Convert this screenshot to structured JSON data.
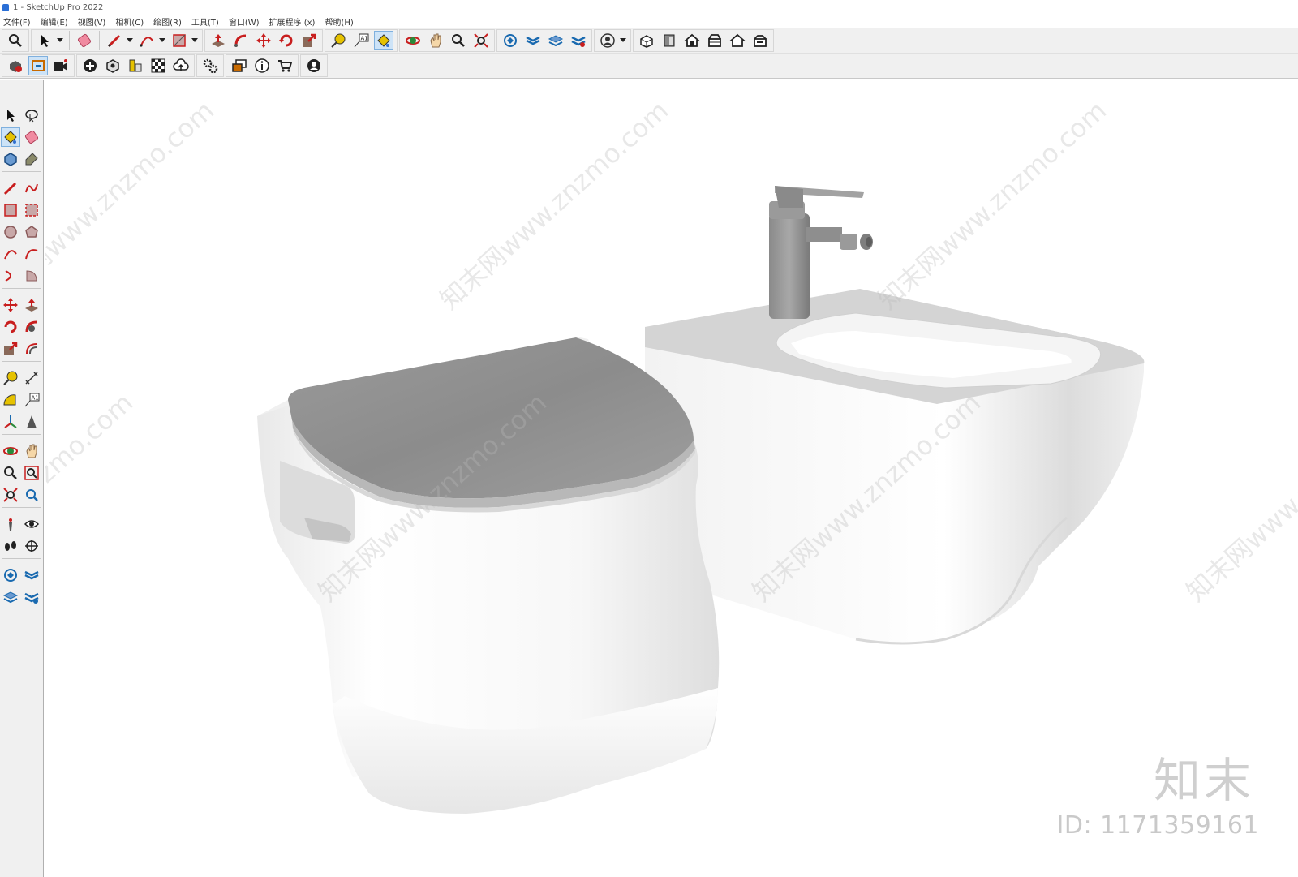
{
  "window": {
    "title": "1 - SketchUp Pro 2022"
  },
  "menu": [
    "文件(F)",
    "编辑(E)",
    "视图(V)",
    "相机(C)",
    "绘图(R)",
    "工具(T)",
    "窗口(W)",
    "扩展程序 (x)",
    "帮助(H)"
  ],
  "toolbar_icons_row1": [
    "zoom-icon",
    "select-icon",
    "eraser-icon",
    "pencil-icon",
    "arc-icon",
    "rectangle-icon",
    "push-pull-icon",
    "follow-me-icon",
    "move-icon",
    "rotate-icon",
    "scale-icon",
    "tape-measure-icon",
    "text-label-icon",
    "paint-bucket-icon",
    "orbit-icon",
    "pan-icon",
    "zoom-window-icon",
    "zoom-extents-icon",
    "components-icon",
    "styles-icon",
    "layers-icon",
    "scenes-icon",
    "account-icon",
    "view-iso-icon",
    "view-top-icon",
    "view-front-icon",
    "view-right-icon",
    "view-back-icon",
    "view-left-icon"
  ],
  "toolbar_icons_row2": [
    "sandbox-icon",
    "section-icon",
    "camera-icon",
    "add-location-icon",
    "model-info-icon",
    "dimensions-icon",
    "texture-icon",
    "cloud-upload-icon",
    "settings-icon",
    "messages-icon",
    "info-icon",
    "cart-icon",
    "user-icon"
  ],
  "watermark": {
    "text": "知末网www.znzmo.com"
  },
  "brand": {
    "logo_text": "知末",
    "id_label": "ID: 1171359161"
  },
  "colors": {
    "accent": "#2a6fd6",
    "toolbar_bg": "#f0f0f0",
    "seat_gray": "#8e8e8e",
    "ceramic": "#ffffff"
  }
}
